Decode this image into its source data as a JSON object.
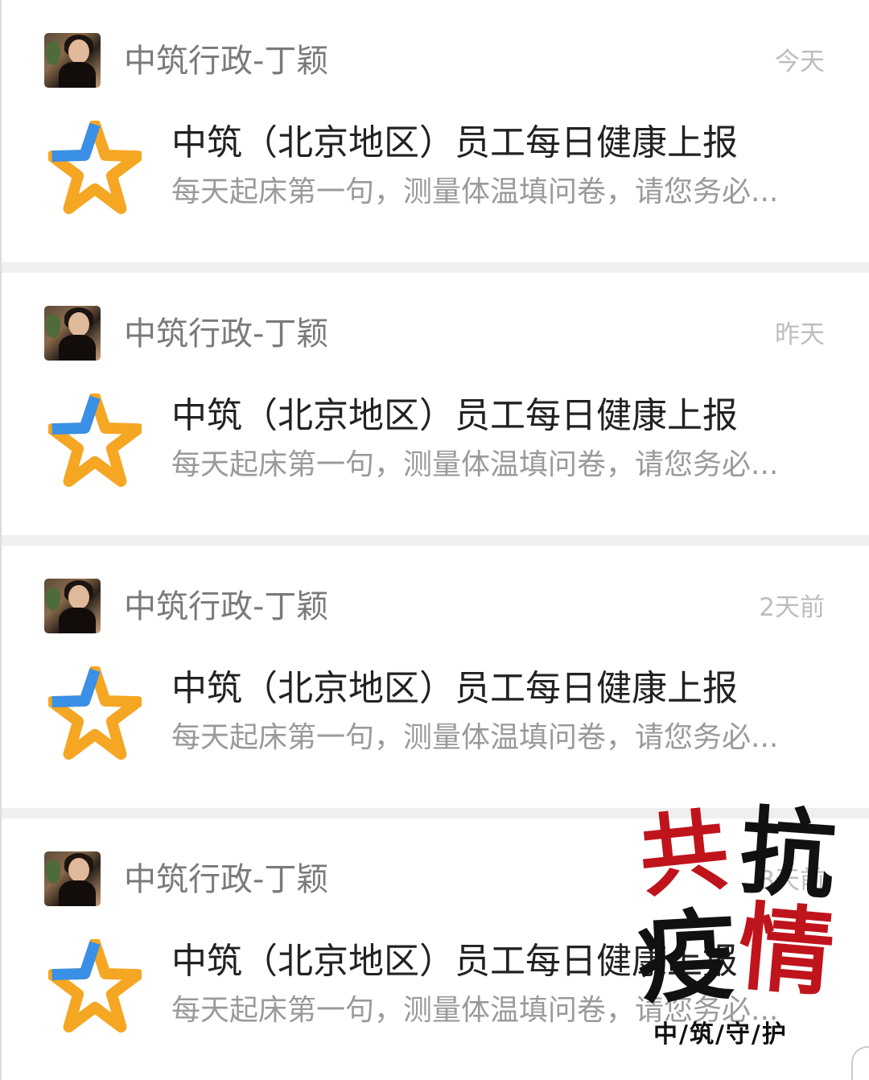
{
  "messages": [
    {
      "sender": "中筑行政-丁颖",
      "time": "今天",
      "title": "中筑（北京地区）员工每日健康上报",
      "preview": "每天起床第一句，测量体温填问卷，请您务必..."
    },
    {
      "sender": "中筑行政-丁颖",
      "time": "昨天",
      "title": "中筑（北京地区）员工每日健康上报",
      "preview": "每天起床第一句，测量体温填问卷，请您务必..."
    },
    {
      "sender": "中筑行政-丁颖",
      "time": "2天前",
      "title": "中筑（北京地区）员工每日健康上报",
      "preview": "每天起床第一句，测量体温填问卷，请您务必..."
    },
    {
      "sender": "中筑行政-丁颖",
      "time": "3天前",
      "title": "中筑（北京地区）员工每日健康上报",
      "preview": "每天起床第一句，测量体温填问卷，请您务必..."
    }
  ],
  "overlay": {
    "chars": [
      "共",
      "抗",
      "疫",
      "情"
    ],
    "slogan": "中/筑/守/护"
  },
  "colors": {
    "overlay_red": "#c0141c",
    "overlay_black": "#111111",
    "star_blue": "#3a8fe6",
    "star_orange": "#f5a623"
  }
}
